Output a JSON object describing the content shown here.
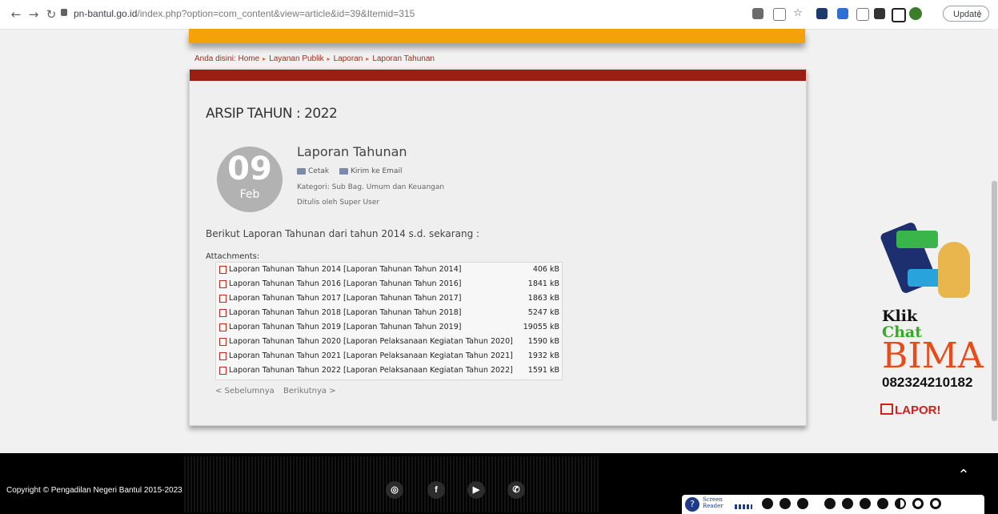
{
  "browser": {
    "url_host": "pn-bantul.go.id",
    "url_path": "/index.php?option=com_content&view=article&id=39&Itemid=315",
    "update_label": "Update",
    "menu_dots": "⋮"
  },
  "breadcrumb": {
    "prefix": "Anda disini:",
    "items": [
      "Home",
      "Layanan Publik",
      "Laporan",
      "Laporan Tahunan"
    ]
  },
  "article": {
    "archive_heading": "ARSIP TAHUN : 2022",
    "day": "09",
    "month": "Feb",
    "title": "Laporan Tahunan",
    "print_label": "Cetak",
    "email_label": "Kirim ke Email",
    "category": "Kategori: Sub Bag. Umum dan Keuangan",
    "author": "Ditulis oleh Super User",
    "intro": "Berikut Laporan Tahunan dari tahun 2014 s.d. sekarang :",
    "attachments_label": "Attachments:",
    "attachments": [
      {
        "name": "Laporan Tahunan Tahun 2014",
        "desc": "[Laporan Tahunan Tahun 2014]",
        "size": "406 kB"
      },
      {
        "name": "Laporan Tahunan Tahun 2016",
        "desc": "[Laporan Tahunan Tahun 2016]",
        "size": "1841 kB"
      },
      {
        "name": "Laporan Tahunan Tahun 2017",
        "desc": "[Laporan Tahunan Tahun 2017]",
        "size": "1863 kB"
      },
      {
        "name": "Laporan Tahunan Tahun 2018",
        "desc": "[Laporan Tahunan Tahun 2018]",
        "size": "5247 kB"
      },
      {
        "name": "Laporan Tahunan Tahun 2019",
        "desc": "[Laporan Tahunan Tahun 2019]",
        "size": "19055 kB"
      },
      {
        "name": "Laporan Tahunan Tahun 2020",
        "desc": "[Laporan Pelaksanaan Kegiatan Tahun 2020]",
        "size": "1590 kB"
      },
      {
        "name": "Laporan Tahunan Tahun 2021",
        "desc": "[Laporan Pelaksanaan Kegiatan Tahun 2021]",
        "size": "1932 kB"
      },
      {
        "name": "Laporan Tahunan Tahun 2022",
        "desc": "[Laporan Pelaksanaan Kegiatan Tahun 2022]",
        "size": "1591 kB"
      }
    ],
    "prev_label": "< Sebelumnya",
    "next_label": "Berikutnya >"
  },
  "ad": {
    "klik": "Klik",
    "chat": "Chat",
    "bima": "BIMA",
    "phone": "082324210182",
    "lapor": "LAPOR!"
  },
  "footer": {
    "copyright": "Copyright © Pengadilan Negeri Bantul 2015-2023",
    "social": [
      "instagram-icon",
      "facebook-icon",
      "youtube-icon",
      "whatsapp-icon"
    ],
    "screen_reader_line1": "Screen",
    "screen_reader_line2": "Reader"
  }
}
